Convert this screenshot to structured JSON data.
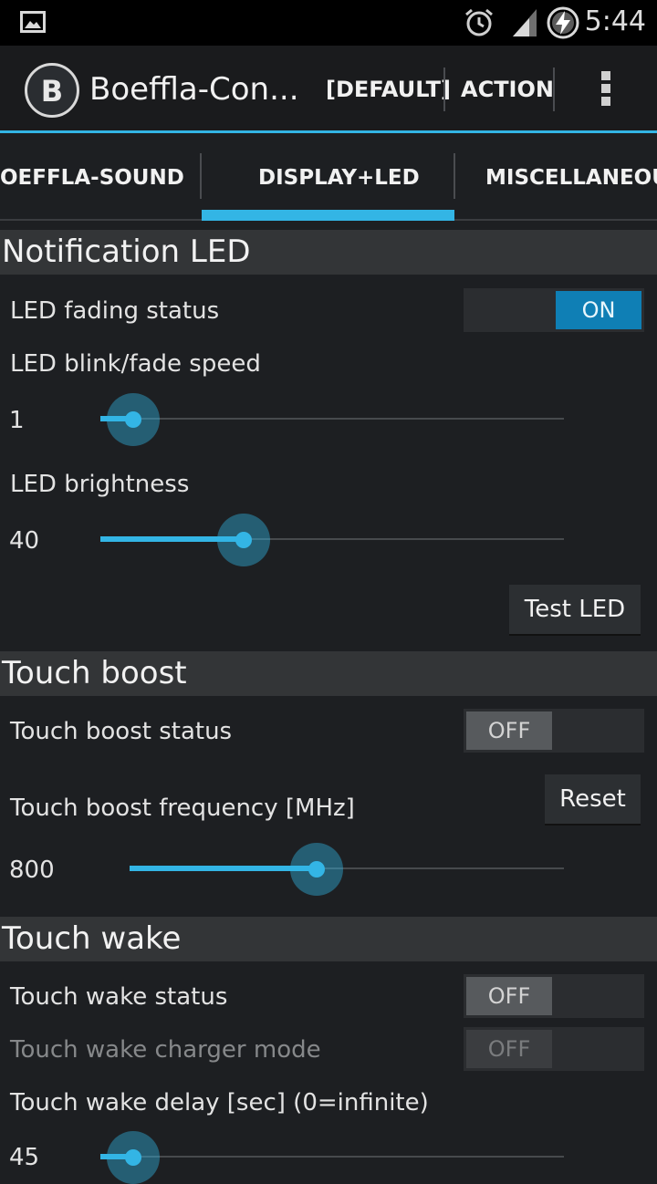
{
  "status_bar": {
    "time": "5:44",
    "icons": [
      "image-icon",
      "alarm-icon",
      "signal-icon",
      "battery-charging-icon"
    ]
  },
  "action_bar": {
    "title": "Boeffla-Con...",
    "default_label": "[DEFAULT]",
    "action_label": "ACTION",
    "logo_letter": "B"
  },
  "tabs": [
    {
      "label": "OEFFLA-SOUND"
    },
    {
      "label": "DISPLAY+LED",
      "selected": true
    },
    {
      "label": "MISCELLANEOUS"
    }
  ],
  "notification_led": {
    "header": "Notification LED",
    "fading_label": "LED fading status",
    "fading_state": "ON",
    "speed_label": "LED blink/fade speed",
    "speed_value": "1",
    "speed_fraction": 0.07,
    "brightness_label": "LED brightness",
    "brightness_value": "40",
    "brightness_fraction": 0.31,
    "test_button": "Test LED"
  },
  "touch_boost": {
    "header": "Touch boost",
    "status_label": "Touch boost status",
    "status_state": "OFF",
    "frequency_label": "Touch boost frequency [MHz]",
    "reset_button": "Reset",
    "frequency_value": "800",
    "frequency_fraction": 0.43
  },
  "touch_wake": {
    "header": "Touch wake",
    "status_label": "Touch wake status",
    "status_state": "OFF",
    "charger_label": "Touch wake charger mode",
    "charger_state": "OFF",
    "delay_label": "Touch wake delay [sec] (0=infinite)",
    "delay_value": "45",
    "delay_fraction": 0.07
  },
  "colors": {
    "accent": "#33b5e5",
    "toggle_on": "#0f7fb5",
    "background": "#1d1f22",
    "section_header": "#333537"
  }
}
